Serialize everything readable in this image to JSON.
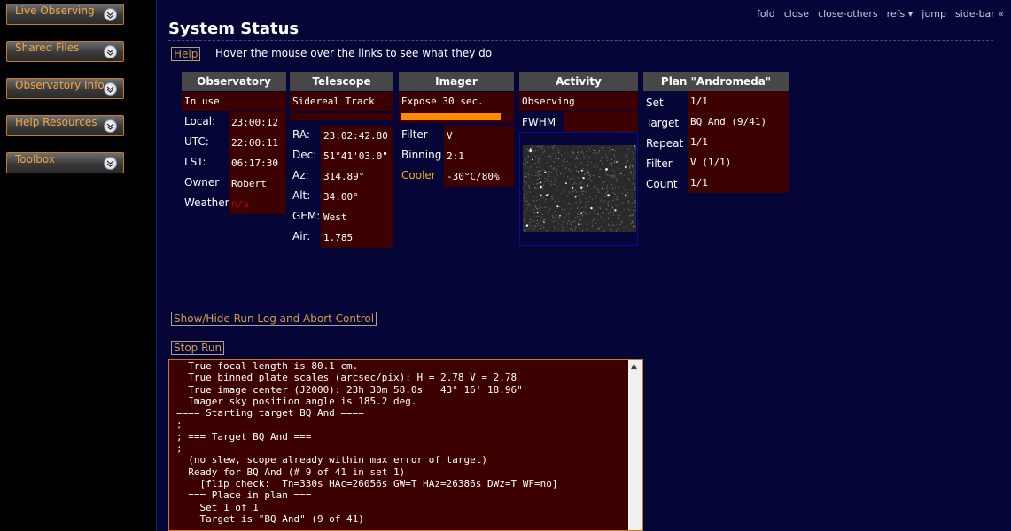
{
  "sidebar": {
    "items": [
      {
        "label": "Live Observing"
      },
      {
        "label": "Shared Files"
      },
      {
        "label": "Observatory Info"
      },
      {
        "label": "Help Resources"
      },
      {
        "label": "Toolbox"
      }
    ]
  },
  "topnav": [
    "fold",
    "close",
    "close-others",
    "refs ▾",
    "jump",
    "side-bar «"
  ],
  "title": "System Status",
  "help_label": "Help",
  "hint": "Hover the mouse over the links to see what they do",
  "observatory": {
    "header": "Observatory",
    "status": "In use",
    "rows": [
      {
        "label": "Local:",
        "value": "23:00:12"
      },
      {
        "label": "UTC:",
        "value": "22:00:11"
      },
      {
        "label": "LST:",
        "value": "06:17:30"
      },
      {
        "label": "Owner",
        "value": "Robert"
      },
      {
        "label": "Weather",
        "value": "n/a"
      }
    ]
  },
  "telescope": {
    "header": "Telescope",
    "status": "Sidereal Track",
    "rows": [
      {
        "label": "RA:",
        "value": "23:02:42.80"
      },
      {
        "label": "Dec:",
        "value": "51°41'03.0\""
      },
      {
        "label": "Az:",
        "value": "314.89°"
      },
      {
        "label": "Alt:",
        "value": "34.00°"
      },
      {
        "label": "GEM:",
        "value": "West"
      },
      {
        "label": "Air:",
        "value": "1.785"
      }
    ]
  },
  "imager": {
    "header": "Imager",
    "status": "Expose 30 sec.",
    "progress": 0.9,
    "rows": [
      {
        "label": "Filter",
        "value": "V"
      },
      {
        "label": "Binning",
        "value": "2:1"
      },
      {
        "label": "Cooler",
        "value": "-30°C/80%"
      }
    ]
  },
  "activity": {
    "header": "Activity",
    "status": "Observing",
    "fwhm_label": "FWHM"
  },
  "plan": {
    "header": "Plan \"Andromeda\"",
    "rows": [
      {
        "label": "Set",
        "value": "1/1"
      },
      {
        "label": "Target",
        "value": "BQ And (9/41)"
      },
      {
        "label": "Repeat",
        "value": "1/1"
      },
      {
        "label": "Filter",
        "value": "V (1/1)"
      },
      {
        "label": "Count",
        "value": "1/1"
      }
    ]
  },
  "runlog_label": "Show/Hide Run Log and Abort Control",
  "stoprun_label": "Stop Run",
  "log_text": "  True focal length is 80.1 cm.\n  True binned plate scales (arcsec/pix): H = 2.78 V = 2.78\n  True image center (J2000): 23h 30m 58.0s   43° 16' 18.96\"\n  Imager sky position angle is 185.2 deg.\n==== Starting target BQ And ====\n;\n; === Target BQ And ===\n;\n  (no slew, scope already within max error of target)\n  Ready for BQ And (# 9 of 41 in set 1)\n    [flip check:  Tn=330s HAc=26056s GW=T HAz=26386s DWz=T WF=no]\n  === Place in plan ===\n    Set 1 of 1\n    Target is \"BQ And\" (9 of 41)",
  "colors": {
    "accent": "#f2a640",
    "value_bg": "#3d0000",
    "main_bg": "#050538",
    "header_bg": "#474747",
    "progress": "#ff8c00",
    "cooler_label": "#f0b000",
    "weather_value": "#b00000"
  }
}
